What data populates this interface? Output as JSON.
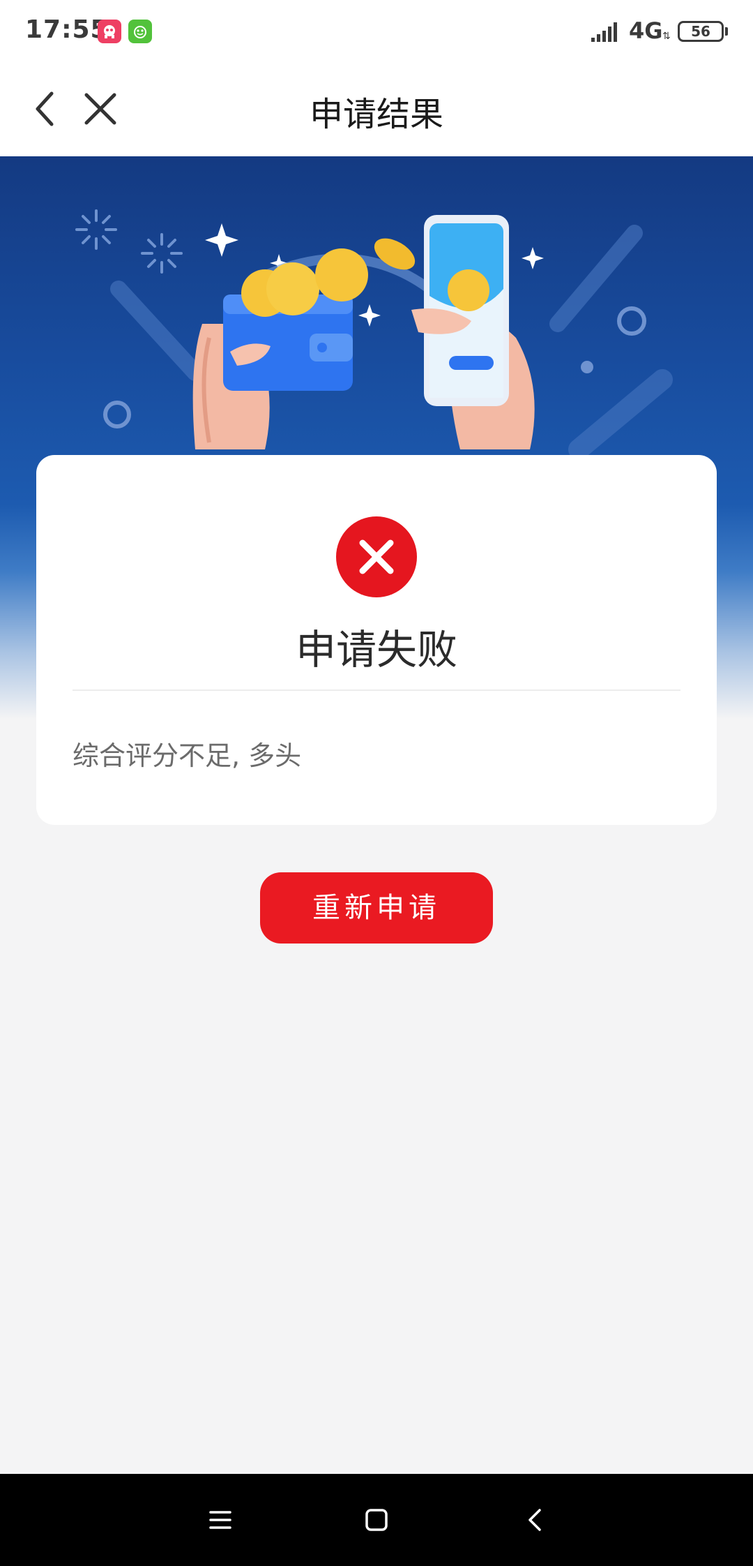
{
  "status_bar": {
    "time": "17:55",
    "network": "4G",
    "battery": "56",
    "app_icons": [
      "elephant-app-icon",
      "frog-app-icon"
    ]
  },
  "nav": {
    "title": "申请结果",
    "back_icon": "chevron-left-icon",
    "close_icon": "close-icon"
  },
  "result": {
    "status_icon": "error-x-icon",
    "title": "申请失败",
    "reason": "综合评分不足, 多头"
  },
  "actions": {
    "retry_label": "重新申请"
  },
  "colors": {
    "accent_red": "#ea1a22",
    "banner_blue": "#184c9e",
    "background": "#f4f4f5"
  },
  "system_nav": {
    "icons": [
      "menu-icon",
      "home-icon",
      "back-icon"
    ]
  }
}
